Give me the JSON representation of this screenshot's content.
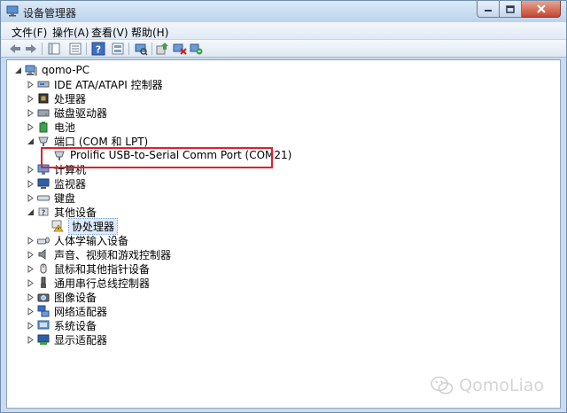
{
  "window": {
    "title": "设备管理器"
  },
  "menu": {
    "items": [
      "文件(F)",
      "操作(A)",
      "查看(V)",
      "帮助(H)"
    ]
  },
  "tree": {
    "root": "qomo-PC",
    "items": [
      {
        "label": "IDE ATA/ATAPI 控制器",
        "icon": "ide-controller-icon"
      },
      {
        "label": "处理器",
        "icon": "processor-icon"
      },
      {
        "label": "磁盘驱动器",
        "icon": "disk-drive-icon"
      },
      {
        "label": "电池",
        "icon": "battery-icon"
      },
      {
        "label": "端口 (COM 和 LPT)",
        "icon": "port-icon",
        "expanded": true
      },
      {
        "label": "Prolific USB-to-Serial Comm Port (COM21)",
        "icon": "port-device-icon",
        "child": true
      },
      {
        "label": "计算机",
        "icon": "computer-icon"
      },
      {
        "label": "监视器",
        "icon": "monitor-icon"
      },
      {
        "label": "键盘",
        "icon": "keyboard-icon"
      },
      {
        "label": "其他设备",
        "icon": "other-devices-icon",
        "expanded": true
      },
      {
        "label": "协处理器",
        "icon": "warning-device-icon",
        "child": true
      },
      {
        "label": "人体学输入设备",
        "icon": "hid-icon"
      },
      {
        "label": "声音、视频和游戏控制器",
        "icon": "sound-icon"
      },
      {
        "label": "鼠标和其他指针设备",
        "icon": "mouse-icon"
      },
      {
        "label": "通用串行总线控制器",
        "icon": "usb-icon"
      },
      {
        "label": "图像设备",
        "icon": "imaging-icon"
      },
      {
        "label": "网络适配器",
        "icon": "network-icon"
      },
      {
        "label": "系统设备",
        "icon": "system-icon"
      },
      {
        "label": "显示适配器",
        "icon": "display-adapter-icon"
      }
    ]
  },
  "watermark": {
    "text": "QomoLiao"
  }
}
